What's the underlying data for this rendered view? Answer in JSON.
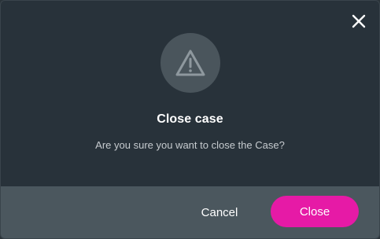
{
  "dialog": {
    "title": "Close case",
    "message": "Are you sure you want to close the Case?",
    "warning_icon": "warning-triangle-icon",
    "close_icon": "close-icon"
  },
  "footer": {
    "cancel_label": "Cancel",
    "close_label": "Close"
  },
  "colors": {
    "dialog_background": "#28323a",
    "footer_background": "#4b575e",
    "icon_circle": "#4a555c",
    "primary_button": "#e61aa6",
    "text_primary": "#ffffff",
    "text_secondary": "#c6cbcf"
  }
}
